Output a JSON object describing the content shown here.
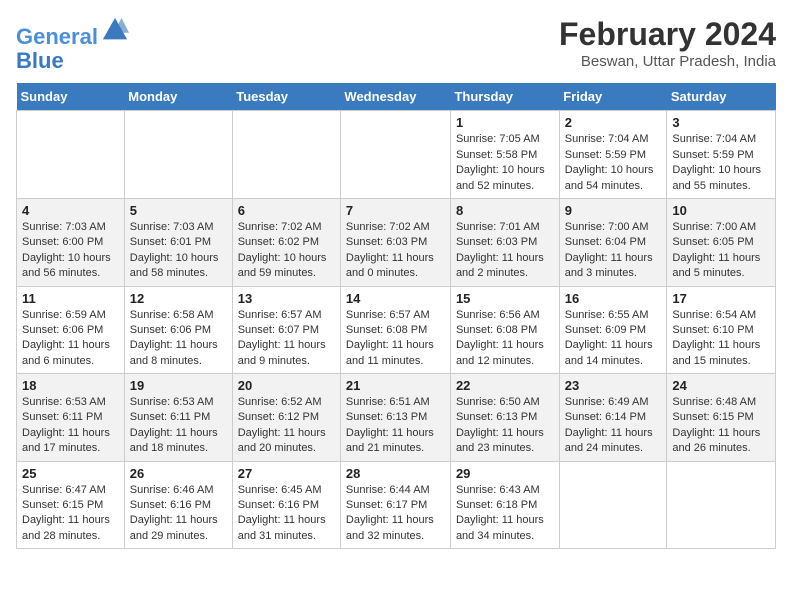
{
  "header": {
    "logo_line1": "General",
    "logo_line2": "Blue",
    "month_year": "February 2024",
    "location": "Beswan, Uttar Pradesh, India"
  },
  "weekdays": [
    "Sunday",
    "Monday",
    "Tuesday",
    "Wednesday",
    "Thursday",
    "Friday",
    "Saturday"
  ],
  "weeks": [
    [
      {
        "day": "",
        "info": ""
      },
      {
        "day": "",
        "info": ""
      },
      {
        "day": "",
        "info": ""
      },
      {
        "day": "",
        "info": ""
      },
      {
        "day": "1",
        "info": "Sunrise: 7:05 AM\nSunset: 5:58 PM\nDaylight: 10 hours\nand 52 minutes."
      },
      {
        "day": "2",
        "info": "Sunrise: 7:04 AM\nSunset: 5:59 PM\nDaylight: 10 hours\nand 54 minutes."
      },
      {
        "day": "3",
        "info": "Sunrise: 7:04 AM\nSunset: 5:59 PM\nDaylight: 10 hours\nand 55 minutes."
      }
    ],
    [
      {
        "day": "4",
        "info": "Sunrise: 7:03 AM\nSunset: 6:00 PM\nDaylight: 10 hours\nand 56 minutes."
      },
      {
        "day": "5",
        "info": "Sunrise: 7:03 AM\nSunset: 6:01 PM\nDaylight: 10 hours\nand 58 minutes."
      },
      {
        "day": "6",
        "info": "Sunrise: 7:02 AM\nSunset: 6:02 PM\nDaylight: 10 hours\nand 59 minutes."
      },
      {
        "day": "7",
        "info": "Sunrise: 7:02 AM\nSunset: 6:03 PM\nDaylight: 11 hours\nand 0 minutes."
      },
      {
        "day": "8",
        "info": "Sunrise: 7:01 AM\nSunset: 6:03 PM\nDaylight: 11 hours\nand 2 minutes."
      },
      {
        "day": "9",
        "info": "Sunrise: 7:00 AM\nSunset: 6:04 PM\nDaylight: 11 hours\nand 3 minutes."
      },
      {
        "day": "10",
        "info": "Sunrise: 7:00 AM\nSunset: 6:05 PM\nDaylight: 11 hours\nand 5 minutes."
      }
    ],
    [
      {
        "day": "11",
        "info": "Sunrise: 6:59 AM\nSunset: 6:06 PM\nDaylight: 11 hours\nand 6 minutes."
      },
      {
        "day": "12",
        "info": "Sunrise: 6:58 AM\nSunset: 6:06 PM\nDaylight: 11 hours\nand 8 minutes."
      },
      {
        "day": "13",
        "info": "Sunrise: 6:57 AM\nSunset: 6:07 PM\nDaylight: 11 hours\nand 9 minutes."
      },
      {
        "day": "14",
        "info": "Sunrise: 6:57 AM\nSunset: 6:08 PM\nDaylight: 11 hours\nand 11 minutes."
      },
      {
        "day": "15",
        "info": "Sunrise: 6:56 AM\nSunset: 6:08 PM\nDaylight: 11 hours\nand 12 minutes."
      },
      {
        "day": "16",
        "info": "Sunrise: 6:55 AM\nSunset: 6:09 PM\nDaylight: 11 hours\nand 14 minutes."
      },
      {
        "day": "17",
        "info": "Sunrise: 6:54 AM\nSunset: 6:10 PM\nDaylight: 11 hours\nand 15 minutes."
      }
    ],
    [
      {
        "day": "18",
        "info": "Sunrise: 6:53 AM\nSunset: 6:11 PM\nDaylight: 11 hours\nand 17 minutes."
      },
      {
        "day": "19",
        "info": "Sunrise: 6:53 AM\nSunset: 6:11 PM\nDaylight: 11 hours\nand 18 minutes."
      },
      {
        "day": "20",
        "info": "Sunrise: 6:52 AM\nSunset: 6:12 PM\nDaylight: 11 hours\nand 20 minutes."
      },
      {
        "day": "21",
        "info": "Sunrise: 6:51 AM\nSunset: 6:13 PM\nDaylight: 11 hours\nand 21 minutes."
      },
      {
        "day": "22",
        "info": "Sunrise: 6:50 AM\nSunset: 6:13 PM\nDaylight: 11 hours\nand 23 minutes."
      },
      {
        "day": "23",
        "info": "Sunrise: 6:49 AM\nSunset: 6:14 PM\nDaylight: 11 hours\nand 24 minutes."
      },
      {
        "day": "24",
        "info": "Sunrise: 6:48 AM\nSunset: 6:15 PM\nDaylight: 11 hours\nand 26 minutes."
      }
    ],
    [
      {
        "day": "25",
        "info": "Sunrise: 6:47 AM\nSunset: 6:15 PM\nDaylight: 11 hours\nand 28 minutes."
      },
      {
        "day": "26",
        "info": "Sunrise: 6:46 AM\nSunset: 6:16 PM\nDaylight: 11 hours\nand 29 minutes."
      },
      {
        "day": "27",
        "info": "Sunrise: 6:45 AM\nSunset: 6:16 PM\nDaylight: 11 hours\nand 31 minutes."
      },
      {
        "day": "28",
        "info": "Sunrise: 6:44 AM\nSunset: 6:17 PM\nDaylight: 11 hours\nand 32 minutes."
      },
      {
        "day": "29",
        "info": "Sunrise: 6:43 AM\nSunset: 6:18 PM\nDaylight: 11 hours\nand 34 minutes."
      },
      {
        "day": "",
        "info": ""
      },
      {
        "day": "",
        "info": ""
      }
    ]
  ]
}
